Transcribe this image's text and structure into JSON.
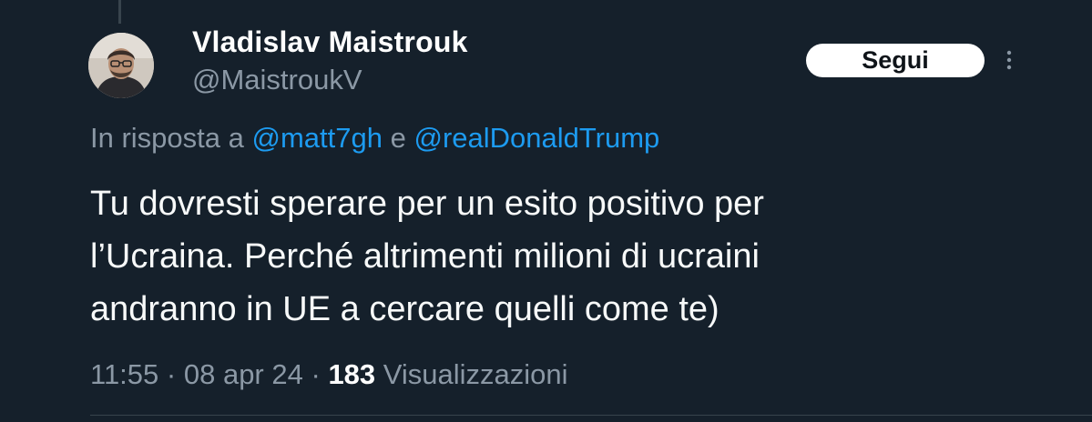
{
  "author": {
    "display_name": "Vladislav Maistrouk",
    "handle": "@MaistroukV"
  },
  "follow_button_label": "Segui",
  "reply_context": {
    "prefix": "In risposta a",
    "mention_1": "@matt7gh",
    "conjunction": "e",
    "mention_2": "@realDonaldTrump"
  },
  "tweet": {
    "lines": [
      "Tu dovresti sperare per un esito positivo per",
      "l’Ucraina. Perché altrimenti milioni di ucraini",
      "andranno in UE a cercare quelli come te)"
    ]
  },
  "meta": {
    "time": "11:55",
    "separator": "·",
    "date": "08 apr 24",
    "views_count": "183",
    "views_label": "Visualizzazioni"
  },
  "colors": {
    "background": "#15202b",
    "accent": "#1d9bf0",
    "secondary_text": "#8b98a5"
  },
  "icons": {
    "more": "more-vertical-icon",
    "avatar": "user-photo"
  }
}
